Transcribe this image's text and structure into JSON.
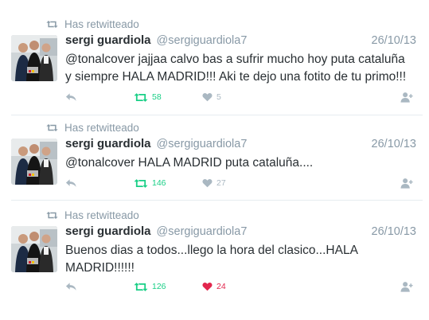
{
  "colors": {
    "retweet_active": "#19cf86",
    "like_active": "#e2264d",
    "muted": "#8899a6",
    "text": "#292f33"
  },
  "tweets": [
    {
      "retweet_label": "Has retwitteado",
      "name": "sergi guardiola",
      "handle": "@sergiguardiola7",
      "date": "26/10/13",
      "text": "@tonalcover jajjaa calvo bas a sufrir mucho hoy puta cataluña\ny siempre HALA MADRID!!! Aki te dejo una fotito de tu primo!!!",
      "retweets": "58",
      "likes": "5",
      "liked": false
    },
    {
      "retweet_label": "Has retwitteado",
      "name": "sergi guardiola",
      "handle": "@sergiguardiola7",
      "date": "26/10/13",
      "text": "@tonalcover HALA MADRID puta cataluña....",
      "retweets": "146",
      "likes": "27",
      "liked": false
    },
    {
      "retweet_label": "Has retwitteado",
      "name": "sergi guardiola",
      "handle": "@sergiguardiola7",
      "date": "26/10/13",
      "text": "Buenos dias a todos...llego la hora del clasico...HALA\nMADRID!!!!!!",
      "retweets": "126",
      "likes": "24",
      "liked": true
    }
  ],
  "icons": {
    "retweet_header": "retweet-icon",
    "reply": "reply-icon",
    "retweet": "retweet-icon",
    "like": "heart-icon",
    "follow": "follow-user-icon"
  }
}
